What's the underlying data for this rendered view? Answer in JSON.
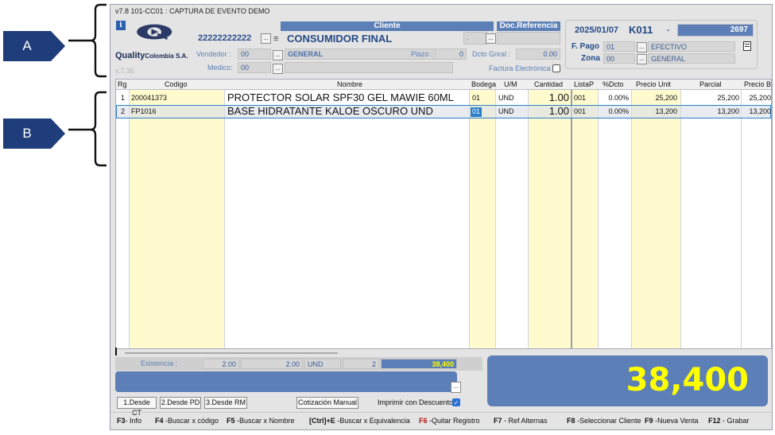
{
  "callouts": {
    "a": "A",
    "b": "B"
  },
  "window": {
    "title": "v7.8 101-CC01 : CAPTURA DE EVENTO DEMO",
    "version_small": "v.7.35"
  },
  "brand": {
    "name": "Quality",
    "suffix": "Colombia S.A.",
    "logo_icon": "quality-logo-icon"
  },
  "header": {
    "cliente_label": "Cliente",
    "docref_label": "Doc.Referencia",
    "client_id": "22222222222",
    "client_name": "CONSUMIDOR FINAL",
    "vendedor_label": "Vendedor :",
    "vendedor_value": "00",
    "vendedor_name": "GENERAL",
    "medico_label": "Medico:",
    "medico_value": "00",
    "plazo_label": "Plazo :",
    "plazo_value": "0",
    "dcto_label": "Dcto Gnral :",
    "dcto_value": "0.00",
    "docref_value": ".",
    "factura_label": "Factura Electrónica",
    "date": "2025/01/07",
    "doc_code": "K011",
    "doc_dot": ".",
    "doc_number": "2697",
    "fpago_label": "F. Pago",
    "fpago_value": "01",
    "fpago_name": "EFECTIVO",
    "zona_label": "Zona",
    "zona_value": "00",
    "zona_name": "GENERAL"
  },
  "grid": {
    "columns": [
      "Rg",
      "Codigo",
      "Nombre",
      "Bodega",
      "U/M",
      "Cantidad",
      "ListaP",
      "%Dcto",
      "Precio Unit",
      "Parcial",
      "Precio B"
    ],
    "rows": [
      {
        "rg": "1",
        "codigo": "200041373",
        "nombre": "PROTECTOR SOLAR SPF30 GEL MAWIE 60ML",
        "bodega": "01",
        "um": "UND",
        "cantidad": "1.00",
        "listap": "001",
        "dcto": "0.00%",
        "precio": "25,200",
        "parcial": "25,200",
        "preciob": "25,200"
      },
      {
        "rg": "2",
        "codigo": "FP1016",
        "nombre": "BASE HIDRATANTE KALOE OSCURO UND",
        "bodega": "01",
        "um": "UND",
        "cantidad": "1.00",
        "listap": "001",
        "dcto": "0.00%",
        "precio": "13,200",
        "parcial": "13,200",
        "preciob": "13,200"
      }
    ]
  },
  "footer": {
    "existencia_label": "Existencia :",
    "exist_1": "2.00",
    "exist_2": "2.00",
    "exist_unit": "UND",
    "exist_count": "2",
    "subtotal": "38,400",
    "total": "38,400",
    "btn_ct": "1.Desde CT",
    "btn_pd": "2.Desde PD",
    "btn_rm": "3.Desde RM",
    "btn_cot": "Cotización Manual",
    "imprimir_label": "Imprimir con Descuento"
  },
  "fkeys": [
    {
      "key": "F3",
      "label": "- Info"
    },
    {
      "key": "F4",
      "label": " -Buscar x código"
    },
    {
      "key": "F5",
      "label": " -Buscar x Nombre"
    },
    {
      "key": "[Ctrl]+E",
      "label": " -Buscar x Equivalencia"
    },
    {
      "key": "F6",
      "label": " -Quitar Registro"
    },
    {
      "key": "F7",
      "label": " - Ref Alternas"
    },
    {
      "key": "F8",
      "label": " -Seleccionar Cliente"
    },
    {
      "key": "F9",
      "label": " -Nueva Venta"
    },
    {
      "key": "F12",
      "label": " - Grabar"
    }
  ],
  "colors": {
    "accent": "#5b7fb6",
    "callout": "#1f3d7a",
    "highlight": "#fffbcf",
    "total": "#ffff00"
  }
}
